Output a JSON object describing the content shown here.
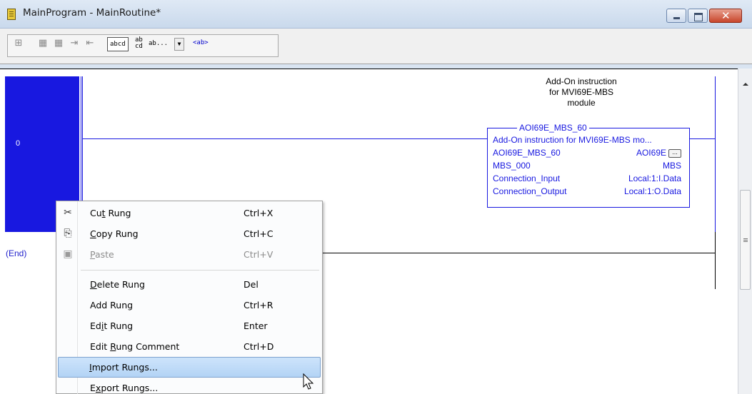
{
  "window": {
    "title": "MainProgram - MainRoutine*"
  },
  "toolbar": {
    "icons": [
      "branch-icon",
      "rung-icon",
      "rung-icon",
      "import-icon",
      "export-icon"
    ],
    "abcd_label": "abcd",
    "abcd_small_top": "ab",
    "abcd_small_bottom": "cd",
    "combo_label": "ab...",
    "tag_label": "<ab>"
  },
  "ladder": {
    "rung_number": "0",
    "end_label": "(End)",
    "comment_lines": [
      "Add-On instruction",
      "for MVI69E-MBS",
      "module"
    ],
    "aoi": {
      "name": "AOI69E_MBS_60",
      "description": "Add-On instruction for MVI69E-MBS mo...",
      "rows": [
        {
          "left": "AOI69E_MBS_60",
          "right": "AOI69E"
        },
        {
          "left": "MBS_000",
          "right": "MBS"
        },
        {
          "left": "Connection_Input",
          "right": "Local:1:I.Data"
        },
        {
          "left": "Connection_Output",
          "right": "Local:1:O.Data"
        }
      ],
      "ellipsis": "..."
    }
  },
  "context_menu": {
    "items": [
      {
        "pre": "Cu",
        "ul": "t",
        "post": " Rung",
        "shortcut": "Ctrl+X",
        "icon": "cut-icon",
        "disabled": false
      },
      {
        "pre": "",
        "ul": "C",
        "post": "opy Rung",
        "shortcut": "Ctrl+C",
        "icon": "copy-icon",
        "disabled": false
      },
      {
        "pre": "",
        "ul": "P",
        "post": "aste",
        "shortcut": "Ctrl+V",
        "icon": "paste-icon",
        "disabled": true
      },
      {
        "pre": "",
        "ul": "D",
        "post": "elete Rung",
        "shortcut": "Del",
        "disabled": false
      },
      {
        "pre": "Add Rung",
        "ul": "",
        "post": "",
        "shortcut": "Ctrl+R",
        "disabled": false
      },
      {
        "pre": "Ed",
        "ul": "i",
        "post": "t Rung",
        "shortcut": "Enter",
        "disabled": false
      },
      {
        "pre": "Edit ",
        "ul": "R",
        "post": "ung Comment",
        "shortcut": "Ctrl+D",
        "disabled": false
      },
      {
        "pre": "",
        "ul": "I",
        "post": "mport Rungs...",
        "shortcut": "",
        "disabled": false,
        "highlighted": true
      },
      {
        "pre": "E",
        "ul": "x",
        "post": "port Rungs...",
        "shortcut": "",
        "disabled": false
      }
    ]
  }
}
